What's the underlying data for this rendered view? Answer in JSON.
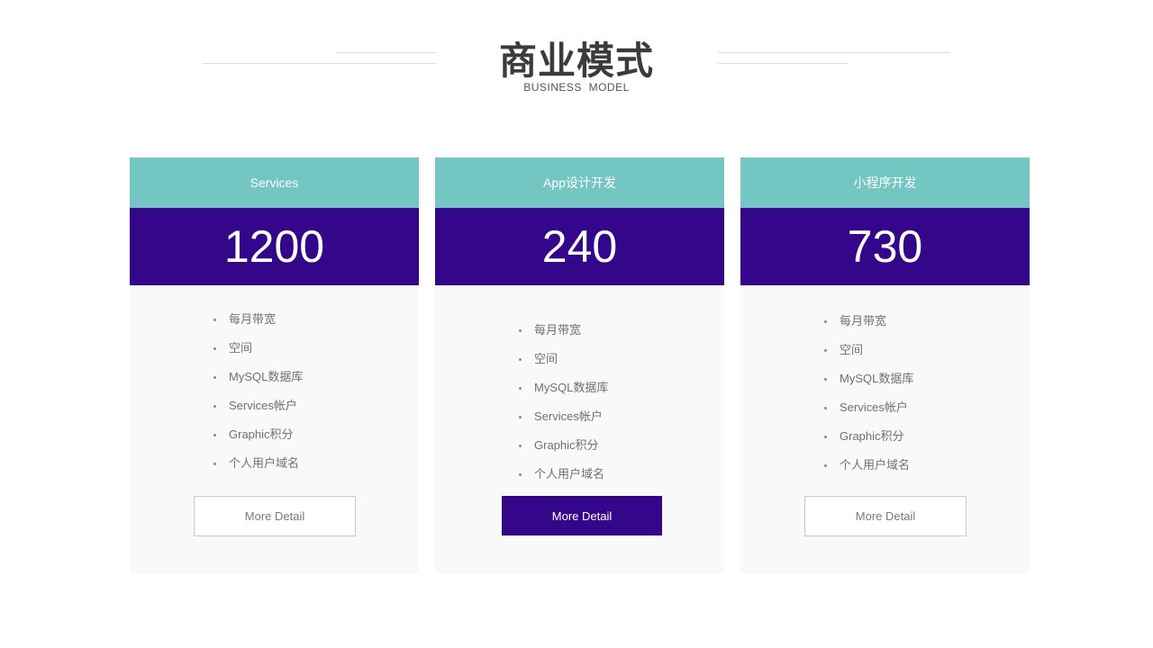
{
  "header": {
    "title": "商业模式",
    "subtitle": "BUSINESS  MODEL"
  },
  "colors": {
    "teal": "#73c6c1",
    "purple": "#34068a",
    "card_bg": "#f9f9f9"
  },
  "cards": [
    {
      "name": "Services",
      "price": "1200",
      "features": [
        "每月带宽",
        "空间",
        "MySQL数据库",
        "Services帐户",
        "Graphic积分",
        "个人用户域名"
      ],
      "button": "More Detail",
      "highlighted": false
    },
    {
      "name": "App设计开发",
      "price": "240",
      "features": [
        "每月带宽",
        "空间",
        "MySQL数据库",
        "Services帐户",
        "Graphic积分",
        "个人用户域名"
      ],
      "button": "More Detail",
      "highlighted": true
    },
    {
      "name": "小程序开发",
      "price": "730",
      "features": [
        "每月带宽",
        "空间",
        "MySQL数据库",
        "Services帐户",
        "Graphic积分",
        "个人用户域名"
      ],
      "button": "More Detail",
      "highlighted": false
    }
  ]
}
